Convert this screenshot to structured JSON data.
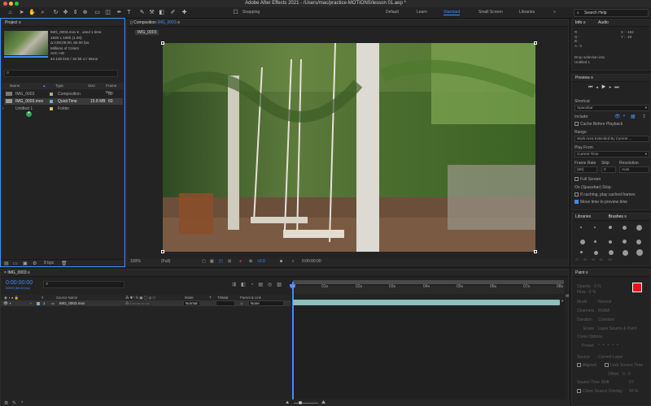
{
  "window": {
    "title": "Adobe After Effects 2021 - /Users/mac/practice-MOTIONS/lesson 01.aep *"
  },
  "toolbar": {
    "snapping_label": "Snapping",
    "workspaces": [
      "Default",
      "Learn",
      "Standard",
      "Small Screen",
      "Libraries"
    ],
    "active_workspace": "Standard",
    "search_placeholder": "Search Help"
  },
  "project": {
    "title": "Project",
    "info": {
      "name": "IMG_0003.mov ▾ , used 1 time",
      "size": "1920 x 1080 (1.00)",
      "duration": "Δ 0;00;08;00, 60.00 fps",
      "colors": "Millions of Colors",
      "codec": "AVC HD",
      "audio": "44.100 kHz / 32 bit U / Mono"
    },
    "columns": [
      "Name",
      "Type",
      "Size",
      "Frame Ra..."
    ],
    "items": [
      {
        "name": "IMG_0003",
        "type": "Composition",
        "size": "",
        "fps": "60",
        "color": "#b5a88a"
      },
      {
        "name": "IMG_0003.mov",
        "type": "QuickTime",
        "size": "15.8 MB",
        "fps": "60",
        "color": "#6fb0c8"
      },
      {
        "name": "Untitled 1",
        "type": "Folder",
        "size": "",
        "fps": "",
        "color": "#d9c25c"
      }
    ],
    "bpc": "8 bpc"
  },
  "composition": {
    "tab_label": "Composition",
    "tab_name": "IMG_0003",
    "breadcrumb": "IMG_0003",
    "zoom": "100%",
    "resolution": "(Full)",
    "exposure": "+0.0",
    "timecode": "0:00:00:00"
  },
  "info_panel": {
    "tabs": [
      "Info",
      "Audio"
    ],
    "channels": [
      "R :",
      "G :",
      "B :",
      "A : 0"
    ],
    "x": "X : -162",
    "y": "Y : -18",
    "message1": "Drop selection into",
    "message2": "Untitled 1"
  },
  "preview": {
    "title": "Preview",
    "shortcut_label": "Shortcut",
    "shortcut_value": "Spacebar",
    "include_label": "Include:",
    "cache_label": "Cache Before Playback",
    "range_label": "Range",
    "range_value": "Work Area Extended By Current ...",
    "play_from_label": "Play From",
    "play_from_value": "Current Time",
    "frame_rate_label": "Frame Rate",
    "skip_label": "Skip",
    "resolution_label": "Resolution",
    "frame_rate_value": "(60)",
    "skip_value": "0",
    "resolution_value": "Auto",
    "full_screen_label": "Full Screen",
    "stop_label": "On (Spacebar) Stop:",
    "caching_label": "If caching, play cached frames",
    "move_time_label": "Move time to preview time"
  },
  "libraries_tabs": [
    "Libraries",
    "Brushes"
  ],
  "brush_sizes": [
    "1",
    "3",
    "5",
    "9",
    "13",
    "19",
    "5",
    "9",
    "13",
    "17",
    "21",
    "27",
    "35",
    "45",
    "65",
    "100"
  ],
  "paint": {
    "title": "Paint",
    "opacity": "Opacity : 0 %",
    "flow": "Flow : 0 %",
    "mode_label": "Mode",
    "mode_value": "Normal",
    "channels_label": "Channels",
    "channels_value": "RGBA",
    "duration_label": "Duration",
    "duration_value": "Constant",
    "erase_label": "Erase",
    "erase_value": "Layer Source & Paint",
    "clone_options": "Clone Options",
    "preset_label": "Preset",
    "source_label": "Source",
    "source_value": "Current Layer",
    "aligned_label": "Aligned",
    "lock_source_label": "Lock Source Time",
    "offset_label": "Offset",
    "offset_value": "0 , 0",
    "source_time_label": "Source Time Shift",
    "source_time_value": "0 f",
    "clone_overlay_label": "Clone Source Overlay",
    "clone_overlay_value": "50 %",
    "foreground": "#e81414",
    "background": "#ffffff"
  },
  "timeline": {
    "tab_name": "IMG_0003",
    "timecode": "0:00:00:00",
    "timecode_sub": "00000 (60.00 fps)",
    "columns": [
      "#",
      "Source Name",
      "Mode",
      "T",
      "TrkMat",
      "Parent & Link"
    ],
    "layers": [
      {
        "index": "1",
        "name": "IMG_0003.mov",
        "mode": "Normal",
        "parent": "None"
      }
    ],
    "ruler": [
      "0s",
      "01s",
      "02s",
      "03s",
      "04s",
      "05s",
      "06s",
      "07s",
      "08s"
    ]
  }
}
